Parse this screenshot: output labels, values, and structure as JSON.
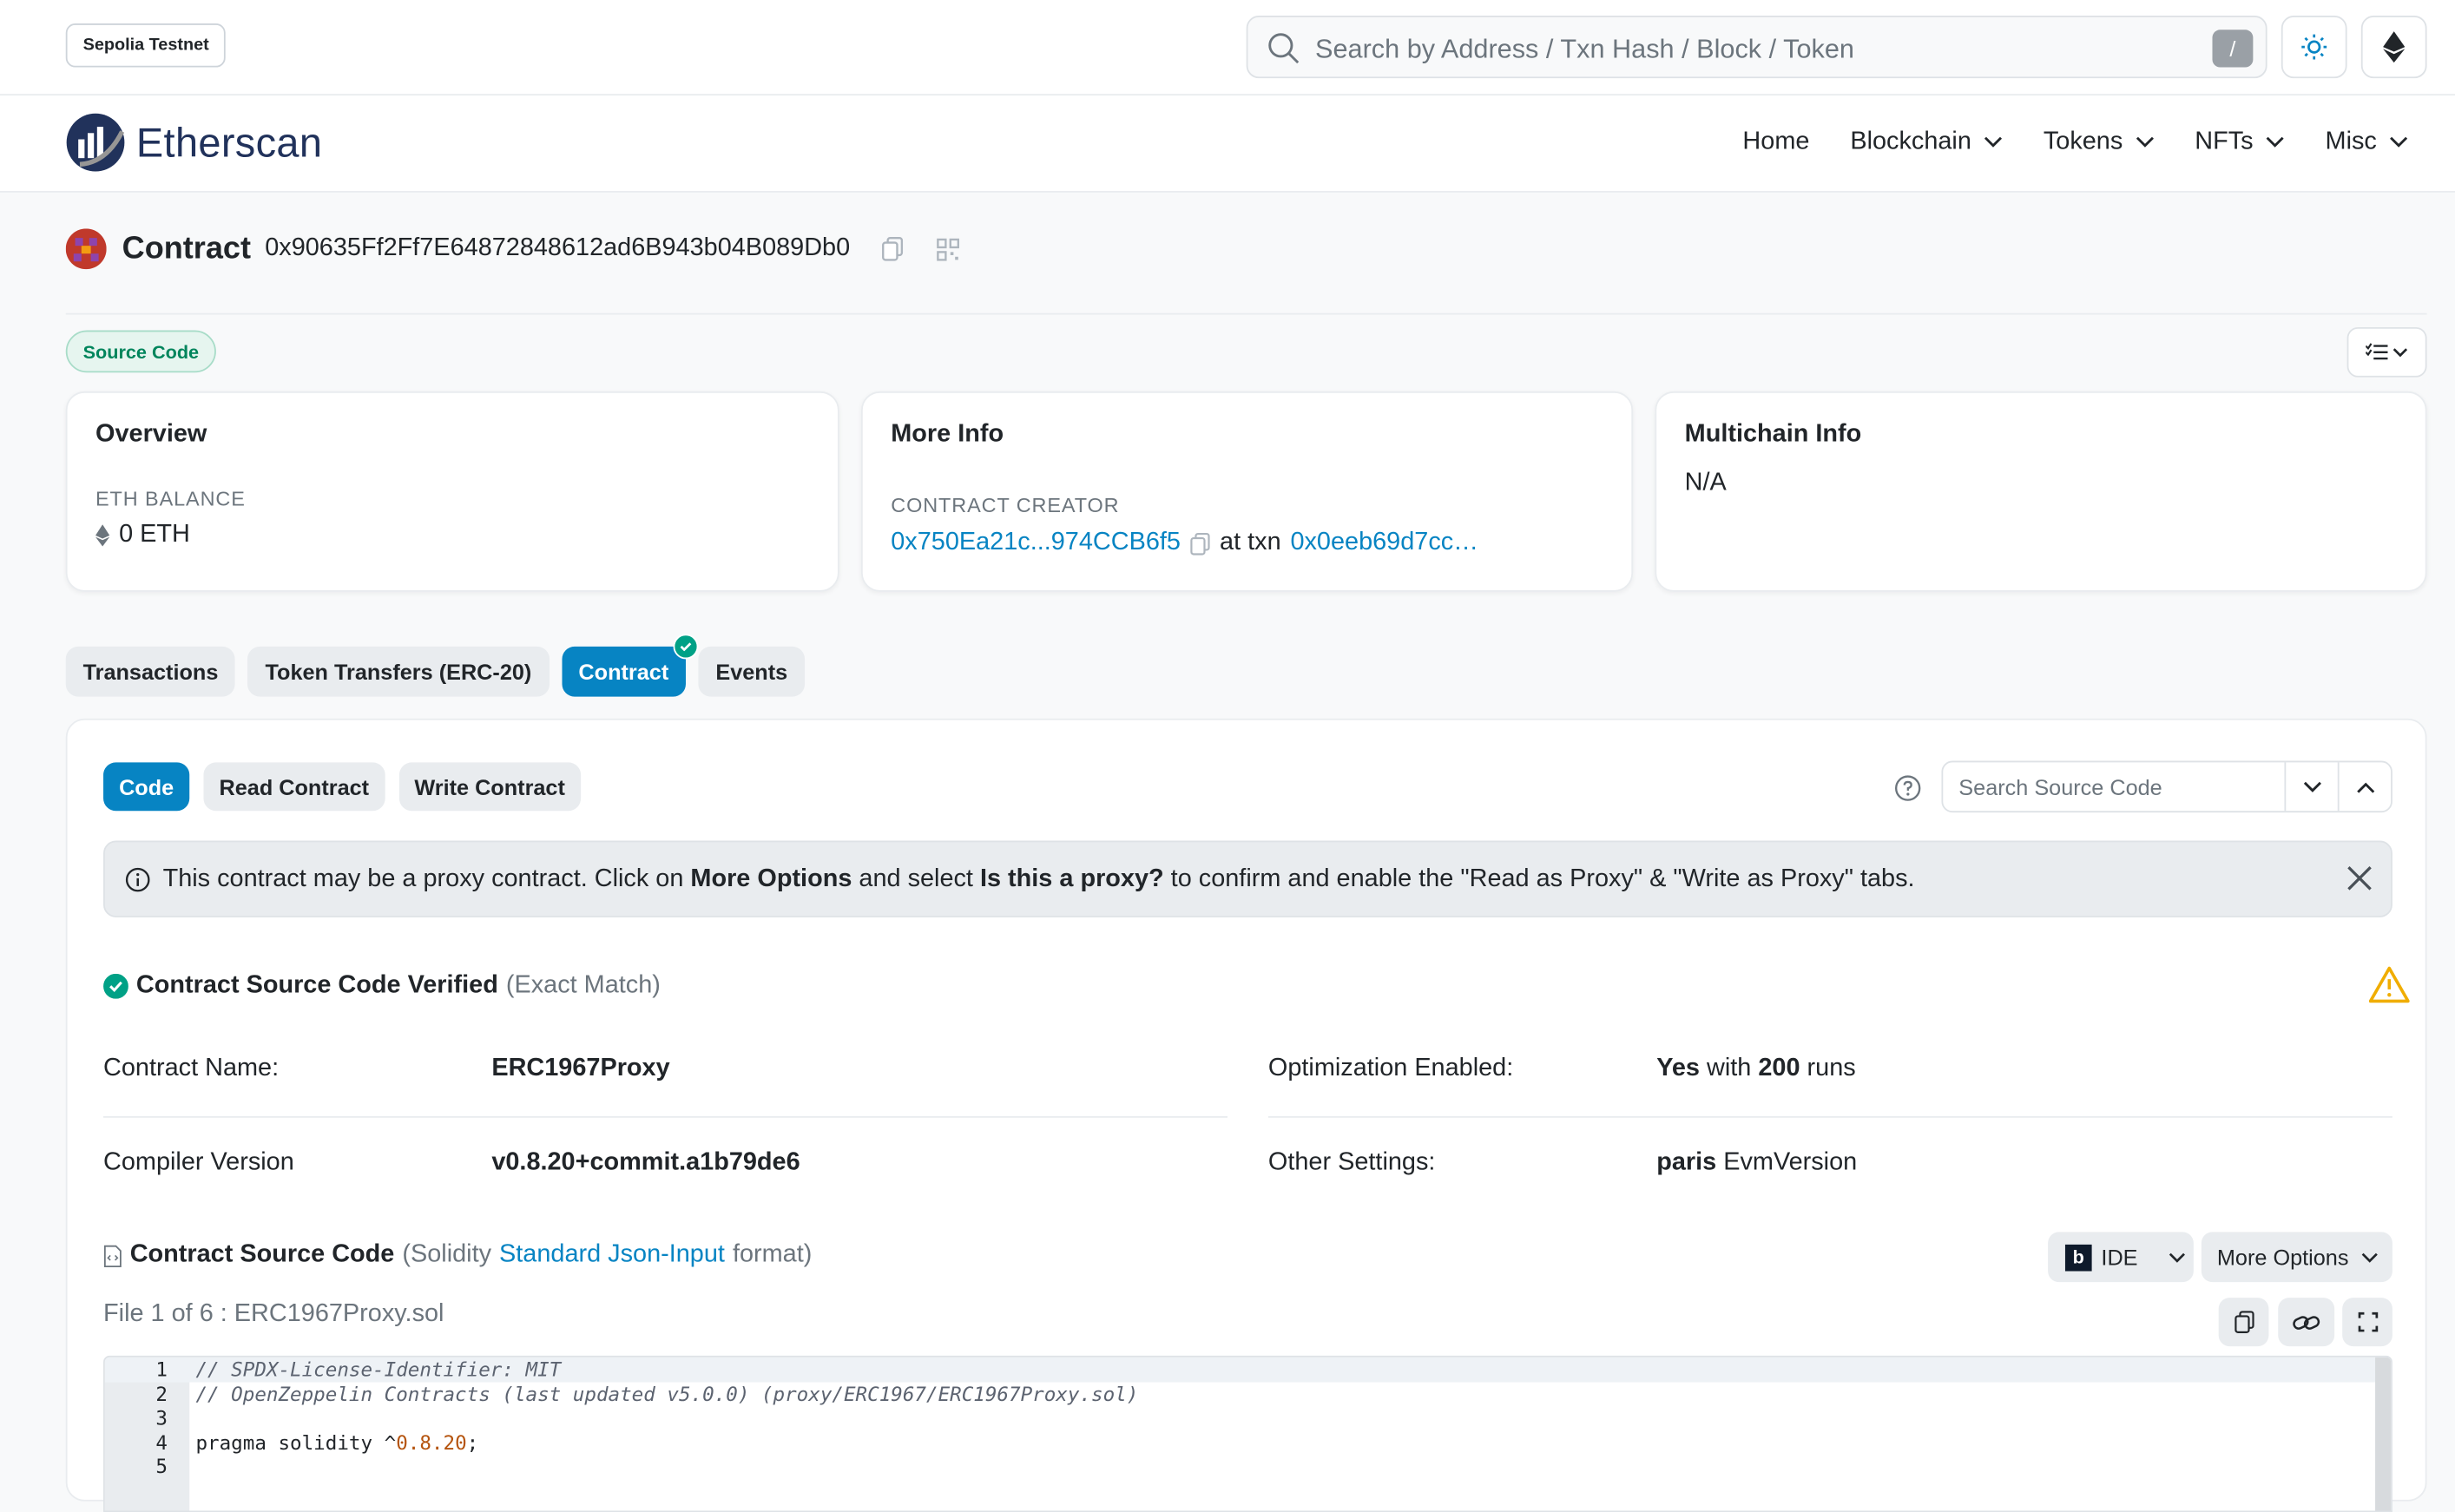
{
  "topbar": {
    "network": "Sepolia Testnet",
    "search_placeholder": "Search by Address / Txn Hash / Block / Token",
    "search_shortcut": "/"
  },
  "nav": {
    "brand": "Etherscan",
    "items": [
      {
        "label": "Home",
        "dropdown": false
      },
      {
        "label": "Blockchain",
        "dropdown": true
      },
      {
        "label": "Tokens",
        "dropdown": true
      },
      {
        "label": "NFTs",
        "dropdown": true
      },
      {
        "label": "Misc",
        "dropdown": true
      }
    ]
  },
  "header": {
    "title": "Contract",
    "address": "0x90635Ff2Ff7E64872848612ad6B943b04B089Db0",
    "source_badge": "Source Code"
  },
  "cards": {
    "overview": {
      "title": "Overview",
      "label": "ETH BALANCE",
      "value": "0 ETH"
    },
    "more_info": {
      "title": "More Info",
      "label": "CONTRACT CREATOR",
      "creator": "0x750Ea21c...974CCB6f5",
      "at_txn": "at txn",
      "txn": "0x0eeb69d7cc…"
    },
    "multichain": {
      "title": "Multichain Info",
      "value": "N/A"
    }
  },
  "tabs": [
    "Transactions",
    "Token Transfers (ERC-20)",
    "Contract",
    "Events"
  ],
  "subtabs": [
    "Code",
    "Read Contract",
    "Write Contract"
  ],
  "source_search_placeholder": "Search Source Code",
  "alert": {
    "part1": "This contract may be a proxy contract. Click on ",
    "bold1": "More Options",
    "part2": " and select ",
    "bold2": "Is this a proxy?",
    "part3": " to confirm and enable the \"Read as Proxy\" & \"Write as Proxy\" tabs."
  },
  "verified": {
    "label": "Contract Source Code Verified",
    "match": "(Exact Match)"
  },
  "details": {
    "name_label": "Contract Name:",
    "name_value": "ERC1967Proxy",
    "opt_label": "Optimization Enabled:",
    "opt_yes": "Yes",
    "opt_with": "with",
    "opt_runs": "200",
    "opt_runs_label": "runs",
    "compiler_label": "Compiler Version",
    "compiler_value": "v0.8.20+commit.a1b79de6",
    "other_label": "Other Settings:",
    "other_bold": "paris",
    "other_rest": "EvmVersion"
  },
  "source": {
    "title": "Contract Source Code",
    "format_open": "(Solidity",
    "format_link": "Standard Json-Input",
    "format_close": "format)",
    "ide_label": "IDE",
    "more_options": "More Options",
    "file_label": "File 1 of 6 : ERC1967Proxy.sol"
  },
  "code_lines": [
    {
      "n": "1",
      "text": "// SPDX-License-Identifier: MIT"
    },
    {
      "n": "2",
      "text": "// OpenZeppelin Contracts (last updated v5.0.0) (proxy/ERC1967/ERC1967Proxy.sol)"
    },
    {
      "n": "3",
      "text": ""
    },
    {
      "n": "4",
      "text_a": "pragma solidity ^",
      "text_num": "0.8.20",
      "text_b": ";"
    },
    {
      "n": "5",
      "text": ""
    }
  ]
}
